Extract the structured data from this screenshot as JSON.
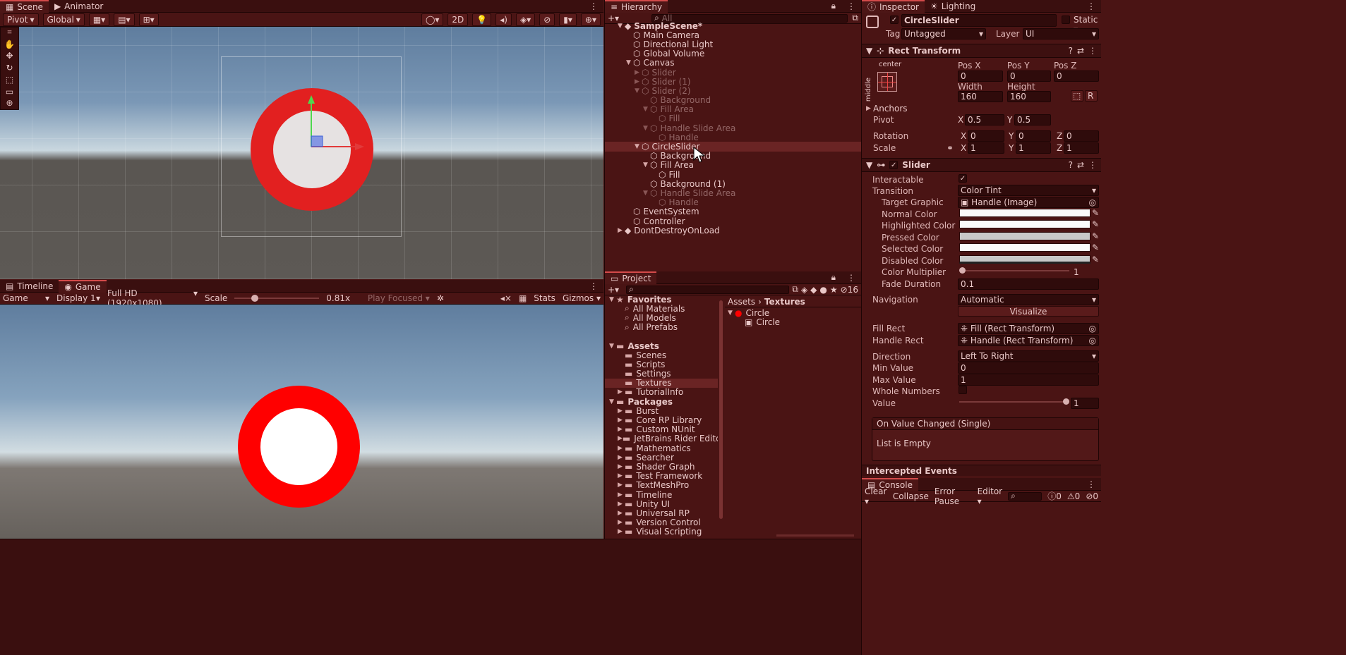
{
  "scene": {
    "tabs": [
      "Scene",
      "Animator"
    ],
    "pivot": "Pivot",
    "global": "Global",
    "twod": "2D"
  },
  "game": {
    "tabs": [
      "Timeline",
      "Game"
    ],
    "mode": "Game",
    "display": "Display 1",
    "resolution": "Full HD (1920x1080)",
    "scale_label": "Scale",
    "scale_value": "0.81x",
    "scale_fraction": 0.22,
    "play_focused": "Play Focused",
    "stats": "Stats",
    "gizmos": "Gizmos"
  },
  "hierarchy": {
    "title": "Hierarchy",
    "search_placeholder": "All",
    "items": [
      {
        "label": "SampleScene*",
        "depth": 0,
        "icon": "unity-scene-icon",
        "arrow": "▼",
        "dim": false,
        "bold": true
      },
      {
        "label": "Main Camera",
        "depth": 1,
        "icon": "gameobject-icon",
        "arrow": "",
        "dim": false
      },
      {
        "label": "Directional Light",
        "depth": 1,
        "icon": "gameobject-icon",
        "arrow": "",
        "dim": false
      },
      {
        "label": "Global Volume",
        "depth": 1,
        "icon": "gameobject-icon",
        "arrow": "",
        "dim": false
      },
      {
        "label": "Canvas",
        "depth": 1,
        "icon": "gameobject-icon",
        "arrow": "▼",
        "dim": false
      },
      {
        "label": "Slider",
        "depth": 2,
        "icon": "gameobject-icon",
        "arrow": "▶",
        "dim": true
      },
      {
        "label": "Slider (1)",
        "depth": 2,
        "icon": "gameobject-icon",
        "arrow": "▶",
        "dim": true
      },
      {
        "label": "Slider (2)",
        "depth": 2,
        "icon": "gameobject-icon",
        "arrow": "▼",
        "dim": true
      },
      {
        "label": "Background",
        "depth": 3,
        "icon": "gameobject-icon",
        "arrow": "",
        "dim": true
      },
      {
        "label": "Fill Area",
        "depth": 3,
        "icon": "gameobject-icon",
        "arrow": "▼",
        "dim": true
      },
      {
        "label": "Fill",
        "depth": 4,
        "icon": "gameobject-icon",
        "arrow": "",
        "dim": true
      },
      {
        "label": "Handle Slide Area",
        "depth": 3,
        "icon": "gameobject-icon",
        "arrow": "▼",
        "dim": true
      },
      {
        "label": "Handle",
        "depth": 4,
        "icon": "gameobject-icon",
        "arrow": "",
        "dim": true
      },
      {
        "label": "CircleSlider",
        "depth": 2,
        "icon": "gameobject-icon",
        "arrow": "▼",
        "dim": false,
        "selected": true
      },
      {
        "label": "Background",
        "depth": 3,
        "icon": "gameobject-icon",
        "arrow": "",
        "dim": false
      },
      {
        "label": "Fill Area",
        "depth": 3,
        "icon": "gameobject-icon",
        "arrow": "▼",
        "dim": false
      },
      {
        "label": "Fill",
        "depth": 4,
        "icon": "gameobject-icon",
        "arrow": "",
        "dim": false
      },
      {
        "label": "Background (1)",
        "depth": 3,
        "icon": "gameobject-icon",
        "arrow": "",
        "dim": false
      },
      {
        "label": "Handle Slide Area",
        "depth": 3,
        "icon": "gameobject-icon",
        "arrow": "▼",
        "dim": true
      },
      {
        "label": "Handle",
        "depth": 4,
        "icon": "gameobject-icon",
        "arrow": "",
        "dim": true
      },
      {
        "label": "EventSystem",
        "depth": 1,
        "icon": "gameobject-icon",
        "arrow": "",
        "dim": false
      },
      {
        "label": "Controller",
        "depth": 1,
        "icon": "gameobject-icon",
        "arrow": "",
        "dim": false
      },
      {
        "label": "DontDestroyOnLoad",
        "depth": 0,
        "icon": "unity-scene-icon",
        "arrow": "▶",
        "dim": false
      }
    ]
  },
  "project": {
    "title": "Project",
    "hidden_count": "16",
    "tree": [
      {
        "label": "Favorites",
        "depth": 0,
        "arrow": "▼",
        "kind": "star",
        "bold": true
      },
      {
        "label": "All Materials",
        "depth": 1,
        "arrow": "",
        "kind": "search"
      },
      {
        "label": "All Models",
        "depth": 1,
        "arrow": "",
        "kind": "search"
      },
      {
        "label": "All Prefabs",
        "depth": 1,
        "arrow": "",
        "kind": "search"
      },
      {
        "label": "",
        "depth": 0,
        "arrow": "",
        "kind": "spacer"
      },
      {
        "label": "Assets",
        "depth": 0,
        "arrow": "▼",
        "kind": "folder",
        "bold": true
      },
      {
        "label": "Scenes",
        "depth": 1,
        "arrow": "",
        "kind": "folder"
      },
      {
        "label": "Scripts",
        "depth": 1,
        "arrow": "",
        "kind": "folder"
      },
      {
        "label": "Settings",
        "depth": 1,
        "arrow": "",
        "kind": "folder"
      },
      {
        "label": "Textures",
        "depth": 1,
        "arrow": "",
        "kind": "folder",
        "selected": true
      },
      {
        "label": "TutorialInfo",
        "depth": 1,
        "arrow": "▶",
        "kind": "folder"
      },
      {
        "label": "Packages",
        "depth": 0,
        "arrow": "▼",
        "kind": "folder",
        "bold": true
      },
      {
        "label": "Burst",
        "depth": 1,
        "arrow": "▶",
        "kind": "folder"
      },
      {
        "label": "Core RP Library",
        "depth": 1,
        "arrow": "▶",
        "kind": "folder"
      },
      {
        "label": "Custom NUnit",
        "depth": 1,
        "arrow": "▶",
        "kind": "folder"
      },
      {
        "label": "JetBrains Rider Editor",
        "depth": 1,
        "arrow": "▶",
        "kind": "folder"
      },
      {
        "label": "Mathematics",
        "depth": 1,
        "arrow": "▶",
        "kind": "folder"
      },
      {
        "label": "Searcher",
        "depth": 1,
        "arrow": "▶",
        "kind": "folder"
      },
      {
        "label": "Shader Graph",
        "depth": 1,
        "arrow": "▶",
        "kind": "folder"
      },
      {
        "label": "Test Framework",
        "depth": 1,
        "arrow": "▶",
        "kind": "folder"
      },
      {
        "label": "TextMeshPro",
        "depth": 1,
        "arrow": "▶",
        "kind": "folder"
      },
      {
        "label": "Timeline",
        "depth": 1,
        "arrow": "▶",
        "kind": "folder"
      },
      {
        "label": "Unity UI",
        "depth": 1,
        "arrow": "▶",
        "kind": "folder"
      },
      {
        "label": "Universal RP",
        "depth": 1,
        "arrow": "▶",
        "kind": "folder"
      },
      {
        "label": "Version Control",
        "depth": 1,
        "arrow": "▶",
        "kind": "folder"
      },
      {
        "label": "Visual Scripting",
        "depth": 1,
        "arrow": "▶",
        "kind": "folder"
      }
    ],
    "breadcrumb": [
      "Assets",
      "Textures"
    ],
    "files": [
      {
        "label": "Circle",
        "depth": 0,
        "arrow": "▼",
        "kind": "circle"
      },
      {
        "label": "Circle",
        "depth": 1,
        "arrow": "",
        "kind": "sprite"
      }
    ]
  },
  "inspector": {
    "tabs": [
      "Inspector",
      "Lighting"
    ],
    "object_name": "CircleSlider",
    "static_label": "Static",
    "tag_label": "Tag",
    "tag_value": "Untagged",
    "layer_label": "Layer",
    "layer_value": "UI",
    "rect_transform": {
      "title": "Rect Transform",
      "anchor_top": "center",
      "anchor_side": "middle",
      "pos_x_label": "Pos X",
      "pos_y_label": "Pos Y",
      "pos_z_label": "Pos Z",
      "pos_x": "0",
      "pos_y": "0",
      "pos_z": "0",
      "width_label": "Width",
      "height_label": "Height",
      "width": "160",
      "height": "160",
      "raw_label": "R",
      "anchors_label": "Anchors",
      "pivot_label": "Pivot",
      "pivot_x": "0.5",
      "pivot_y": "0.5",
      "rotation_label": "Rotation",
      "rot_x": "0",
      "rot_y": "0",
      "rot_z": "0",
      "scale_label": "Scale",
      "scale_x": "1",
      "scale_y": "1",
      "scale_z": "1",
      "x": "X",
      "y": "Y",
      "z": "Z"
    },
    "slider": {
      "title": "Slider",
      "interactable_label": "Interactable",
      "transition_label": "Transition",
      "transition_value": "Color Tint",
      "target_graphic_label": "Target Graphic",
      "target_graphic_value": "Handle (Image)",
      "normal_color_label": "Normal Color",
      "highlighted_color_label": "Highlighted Color",
      "pressed_color_label": "Pressed Color",
      "selected_color_label": "Selected Color",
      "disabled_color_label": "Disabled Color",
      "color_multiplier_label": "Color Multiplier",
      "color_multiplier_value": "1",
      "fade_duration_label": "Fade Duration",
      "fade_duration_value": "0.1",
      "navigation_label": "Navigation",
      "navigation_value": "Automatic",
      "visualize_label": "Visualize",
      "fill_rect_label": "Fill Rect",
      "fill_rect_value": "Fill (Rect Transform)",
      "handle_rect_label": "Handle Rect",
      "handle_rect_value": "Handle (Rect Transform)",
      "direction_label": "Direction",
      "direction_value": "Left To Right",
      "min_value_label": "Min Value",
      "min_value": "0",
      "max_value_label": "Max Value",
      "max_value": "1",
      "whole_numbers_label": "Whole Numbers",
      "value_label": "Value",
      "value": "1",
      "event_title": "On Value Changed (Single)",
      "event_empty": "List is Empty"
    },
    "intercepted_events": "Intercepted Events"
  },
  "console": {
    "title": "Console",
    "clear": "Clear",
    "collapse": "Collapse",
    "error_pause": "Error Pause",
    "editor": "Editor",
    "info_count": "0",
    "warn_count": "0",
    "error_count": "0"
  },
  "colors": {
    "accent": "#d34a4a",
    "ring": "#ff0000",
    "panel": "#4a1414"
  }
}
